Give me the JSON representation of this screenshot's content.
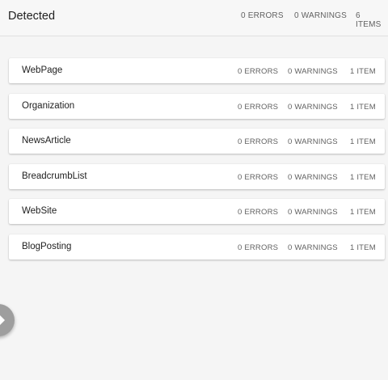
{
  "header": {
    "title": "Detected",
    "errors": "0 ERRORS",
    "warnings": "0 WARNINGS",
    "items": "6 ITEMS"
  },
  "cards": [
    {
      "name": "WebPage",
      "errors": "0 ERRORS",
      "warnings": "0 WARNINGS",
      "items": "1 ITEM"
    },
    {
      "name": "Organization",
      "errors": "0 ERRORS",
      "warnings": "0 WARNINGS",
      "items": "1 ITEM"
    },
    {
      "name": "NewsArticle",
      "errors": "0 ERRORS",
      "warnings": "0 WARNINGS",
      "items": "1 ITEM"
    },
    {
      "name": "BreadcrumbList",
      "errors": "0 ERRORS",
      "warnings": "0 WARNINGS",
      "items": "1 ITEM"
    },
    {
      "name": "WebSite",
      "errors": "0 ERRORS",
      "warnings": "0 WARNINGS",
      "items": "1 ITEM"
    },
    {
      "name": "BlogPosting",
      "errors": "0 ERRORS",
      "warnings": "0 WARNINGS",
      "items": "1 ITEM"
    }
  ],
  "fab": {
    "icon": "chevron-right-icon",
    "color": "#9e9e9e"
  }
}
